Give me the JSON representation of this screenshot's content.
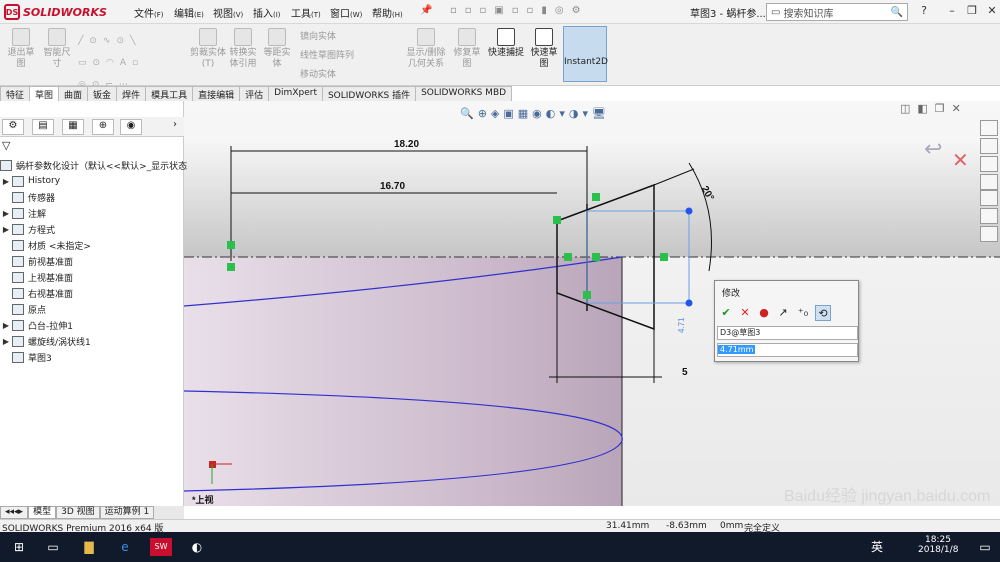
{
  "app": {
    "brand": "SOLIDWORKS",
    "title": "草图3 - 蜗杆参..."
  },
  "menu": [
    {
      "label": "文件",
      "key": "(F)"
    },
    {
      "label": "编辑",
      "key": "(E)"
    },
    {
      "label": "视图",
      "key": "(V)"
    },
    {
      "label": "插入",
      "key": "(I)"
    },
    {
      "label": "工具",
      "key": "(T)"
    },
    {
      "label": "窗口",
      "key": "(W)"
    },
    {
      "label": "帮助",
      "key": "(H)"
    }
  ],
  "search": {
    "placeholder": "搜索知识库"
  },
  "ribbon": {
    "exit_sketch": "退出草图",
    "smart_dim": "智能尺寸",
    "trim": "剪裁实体(T)",
    "convert": "转换实体引用",
    "offset": "等距实体",
    "mirror": "镜向实体",
    "linear_pattern": "线性草图阵列",
    "move": "移动实体",
    "show_relations": "显示/删除几何关系",
    "repair": "修复草图",
    "quick_snap": "快速捕捉",
    "quick_sketch": "快速草图",
    "instant2d": "Instant2D"
  },
  "tabs": [
    "特征",
    "草图",
    "曲面",
    "钣金",
    "焊件",
    "模具工具",
    "直接编辑",
    "评估",
    "DimXpert",
    "SOLIDWORKS 插件",
    "SOLIDWORKS MBD"
  ],
  "active_tab": "草图",
  "tree": {
    "root": "蜗杆参数化设计（默认<<默认>_显示状态",
    "items": [
      {
        "label": "History",
        "exp": "▶"
      },
      {
        "label": "传感器",
        "exp": ""
      },
      {
        "label": "注解",
        "exp": "▶"
      },
      {
        "label": "方程式",
        "exp": "▶"
      },
      {
        "label": "材质 <未指定>",
        "exp": ""
      },
      {
        "label": "前视基准面",
        "exp": ""
      },
      {
        "label": "上视基准面",
        "exp": ""
      },
      {
        "label": "右视基准面",
        "exp": ""
      },
      {
        "label": "原点",
        "exp": ""
      },
      {
        "label": "凸台-拉伸1",
        "exp": "▶"
      },
      {
        "label": "螺旋线/涡状线1",
        "exp": "▶"
      },
      {
        "label": "草图3",
        "exp": ""
      }
    ]
  },
  "dims": {
    "d1": "18.20",
    "d2": "16.70",
    "angle": "20°",
    "d5": "5",
    "d_vert": "4.71"
  },
  "view_label": "*上视",
  "modify": {
    "title": "修改",
    "dim_name": "D3@草图3",
    "value": "4.71mm"
  },
  "bottom_tabs": [
    "模型",
    "3D 视图",
    "运动算例 1"
  ],
  "status": {
    "product": "SOLIDWORKS Premium 2016 x64 版",
    "x": "31.41mm",
    "y": "-8.63mm",
    "z": "0mm",
    "state": "完全定义"
  },
  "taskbar": {
    "time": "18:25",
    "date": "2018/1/8",
    "lang": "英"
  },
  "watermark": "Baidu经验 jingyan.baidu.com"
}
